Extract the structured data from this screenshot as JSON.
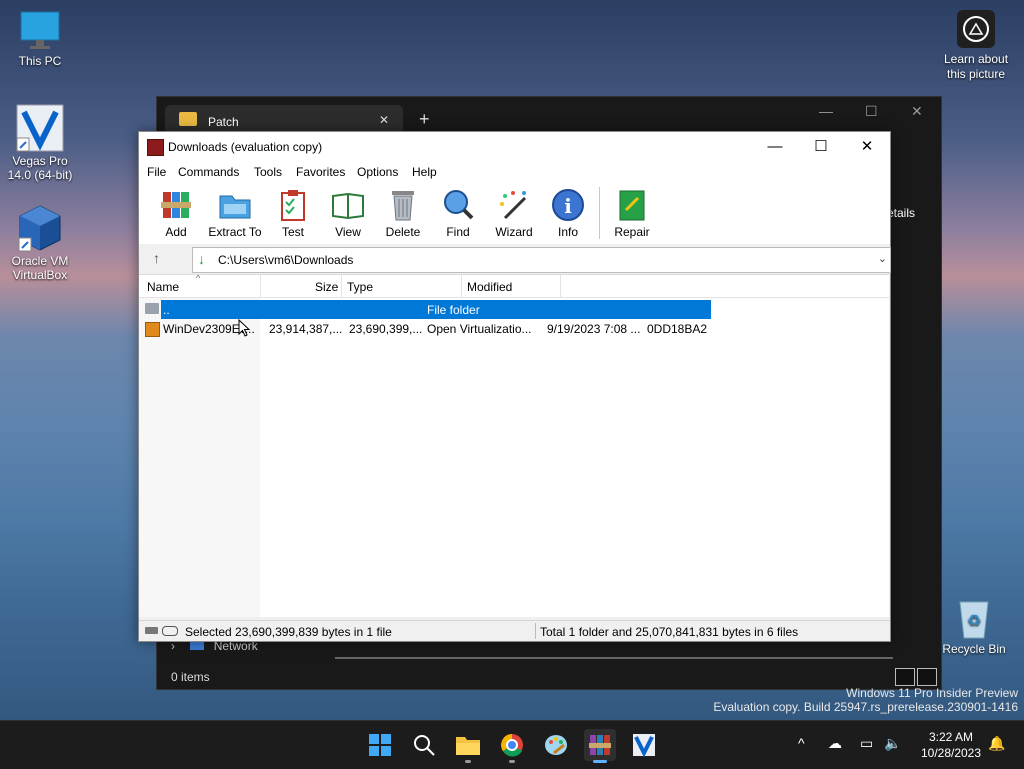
{
  "desktop": {
    "icons": [
      {
        "label": "This PC"
      },
      {
        "label": "Vegas Pro 14.0 (64-bit)"
      },
      {
        "label": "Oracle VM VirtualBox"
      },
      {
        "label": "Recycle Bin"
      }
    ],
    "learn_label": "Learn about this picture"
  },
  "explorer": {
    "tab_title": "Patch",
    "details_label": "etails",
    "network_label": "Network",
    "items_count": "0 items"
  },
  "winrar": {
    "title": "Downloads (evaluation copy)",
    "menu": [
      "File",
      "Commands",
      "Tools",
      "Favorites",
      "Options",
      "Help"
    ],
    "toolbar": [
      "Add",
      "Extract To",
      "Test",
      "View",
      "Delete",
      "Find",
      "Wizard",
      "Info",
      "Repair"
    ],
    "path": "C:\\Users\\vm6\\Downloads",
    "columns": [
      "Name",
      "Size",
      "Type",
      "Modified"
    ],
    "rows": [
      {
        "name": "..",
        "size": "",
        "packed": "",
        "type": "File folder",
        "modified": "",
        "crc": ""
      },
      {
        "name": "WinDev2309Ev...",
        "size": "23,914,387,...",
        "packed": "23,690,399,...",
        "type": "Open Virtualizatio...",
        "modified": "9/19/2023 7:08 ...",
        "crc": "0DD18BA2"
      }
    ],
    "status_left": "Selected 23,690,399,839 bytes in 1 file",
    "status_right": "Total 1 folder and 25,070,841,831 bytes in 6 files"
  },
  "watermark": {
    "line1": "Windows 11 Pro Insider Preview",
    "line2": "Evaluation copy. Build 25947.rs_prerelease.230901-1416"
  },
  "taskbar": {
    "time": "3:22 AM",
    "date": "10/28/2023"
  }
}
